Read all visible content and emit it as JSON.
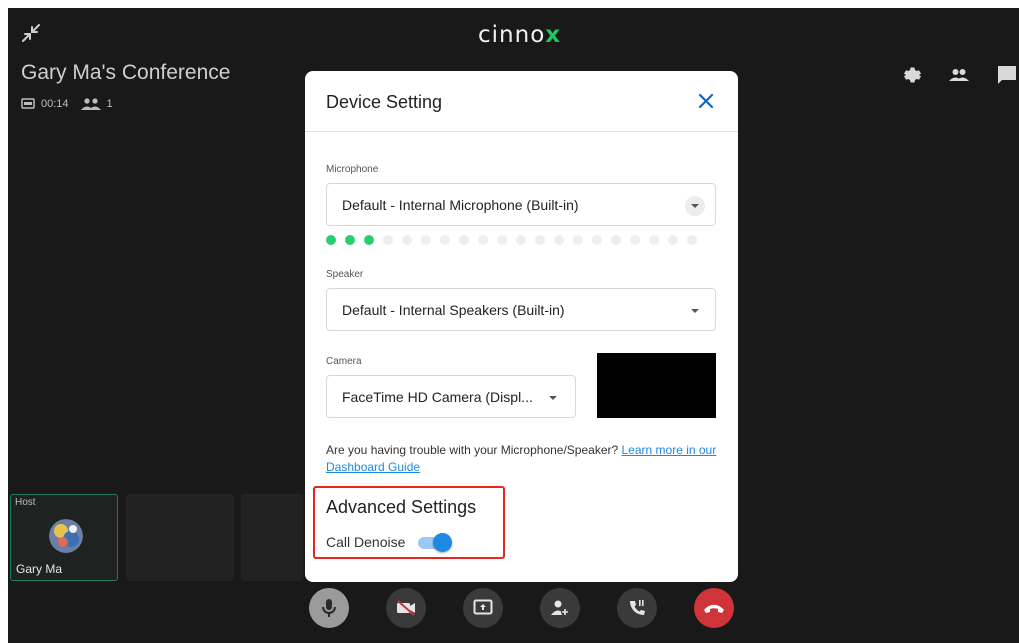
{
  "header": {
    "brand": "cinno",
    "brand_suffix": "x",
    "conference_title": "Gary Ma's Conference",
    "timer": "00:14",
    "participant_count": "1"
  },
  "top_icons": [
    "settings-icon",
    "participants-icon",
    "chat-icon"
  ],
  "participants": [
    {
      "role_label": "Host",
      "name": "Gary Ma"
    }
  ],
  "controls": [
    "microphone",
    "camera-off",
    "share-screen",
    "invite-participant",
    "dial-call",
    "end-call"
  ],
  "device_setting": {
    "title": "Device Setting",
    "microphone": {
      "label": "Microphone",
      "value": "Default - Internal Microphone (Built-in)",
      "level_total": 20,
      "level_active": 3
    },
    "speaker": {
      "label": "Speaker",
      "value": "Default - Internal Speakers (Built-in)"
    },
    "camera": {
      "label": "Camera",
      "value": "FaceTime HD Camera (Displ..."
    },
    "help_text": "Are you having trouble with your Microphone/Speaker? ",
    "help_link": "Learn more in our Dashboard Guide",
    "advanced": {
      "title": "Advanced Settings",
      "call_denoise_label": "Call Denoise",
      "call_denoise_on": true
    }
  },
  "colors": {
    "accent": "#1e88e5",
    "level_active": "#2ecc71",
    "end_call": "#d13438",
    "highlight": "#e8251b",
    "brand_x": "#22c55e"
  }
}
